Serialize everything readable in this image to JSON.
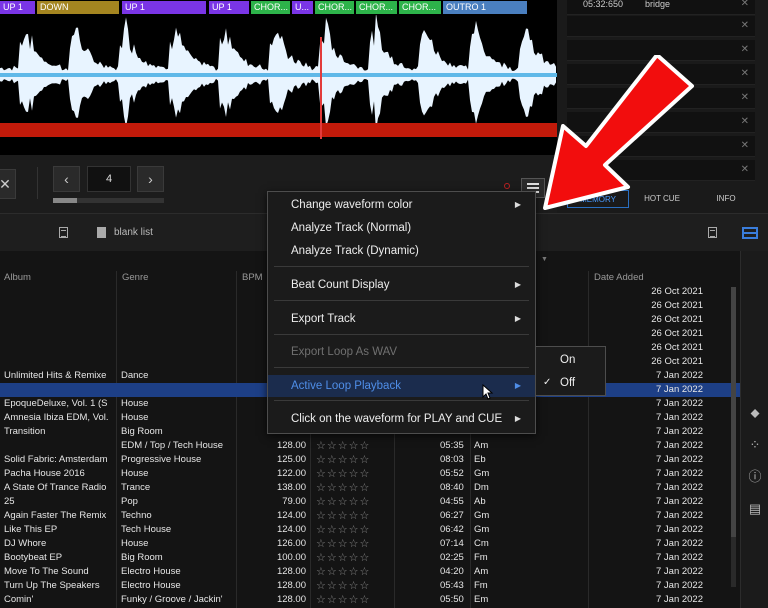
{
  "phrases": [
    {
      "label": "UP 1",
      "color": "#7a35e6"
    },
    {
      "label": "DOWN",
      "color": "#a48520"
    },
    {
      "label": "UP 1",
      "color": "#7a35e6"
    },
    {
      "label": "UP 1",
      "color": "#7a35e6"
    },
    {
      "label": "CHOR...",
      "color": "#2db34a"
    },
    {
      "label": "U...",
      "color": "#7a35e6"
    },
    {
      "label": "CHOR...",
      "color": "#2db34a"
    },
    {
      "label": "CHOR...",
      "color": "#2db34a"
    },
    {
      "label": "CHOR...",
      "color": "#2db34a"
    },
    {
      "label": "OUTRO 1",
      "color": "#4a7fbf"
    }
  ],
  "memory": {
    "first_time": "05:32:650",
    "first_name": "bridge",
    "tabs": [
      "MEMORY",
      "HOT CUE",
      "INFO"
    ]
  },
  "deck": {
    "loop_beats": "4"
  },
  "browser": {
    "playlist_name": "blank list"
  },
  "columns": {
    "album": "Album",
    "genre": "Genre",
    "bpm": "BPM",
    "date_added": "Date Added"
  },
  "rows": [
    {
      "album": "",
      "genre": "",
      "bpm": "",
      "time": "",
      "key": "",
      "date": "26 Oct 2021",
      "stars": false
    },
    {
      "album": "",
      "genre": "",
      "bpm": "",
      "time": "",
      "key": "",
      "date": "26 Oct 2021",
      "stars": false
    },
    {
      "album": "",
      "genre": "",
      "bpm": "",
      "time": "",
      "key": "",
      "date": "26 Oct 2021",
      "stars": false
    },
    {
      "album": "",
      "genre": "",
      "bpm": "",
      "time": "",
      "key": "",
      "date": "26 Oct 2021",
      "stars": false
    },
    {
      "album": "",
      "genre": "",
      "bpm": "",
      "time": "",
      "key": "",
      "date": "26 Oct 2021",
      "stars": false
    },
    {
      "album": "",
      "genre": "",
      "bpm": "",
      "time": "",
      "key": "",
      "date": "26 Oct 2021",
      "stars": false
    },
    {
      "album": "Unlimited Hits & Remixe",
      "genre": "Dance",
      "bpm": "",
      "time": "",
      "key": "",
      "date": "7 Jan 2022",
      "stars": false
    },
    {
      "album": "",
      "genre": "",
      "bpm": "",
      "time": "",
      "key": "",
      "date": "7 Jan 2022",
      "stars": false,
      "selected": true
    },
    {
      "album": "EpoqueDeluxe, Vol. 1 (S",
      "genre": "House",
      "bpm": "",
      "time": "",
      "key": "",
      "date": "7 Jan 2022",
      "stars": false
    },
    {
      "album": "Amnesia Ibiza EDM, Vol.",
      "genre": "House",
      "bpm": "",
      "time": "",
      "key": "",
      "date": "7 Jan 2022",
      "stars": false
    },
    {
      "album": "Transition",
      "genre": "Big Room",
      "bpm": "",
      "time": "",
      "key": "",
      "date": "7 Jan 2022",
      "stars": false
    },
    {
      "album": "",
      "genre": "EDM / Top / Tech House",
      "bpm": "128.00",
      "time": "05:35",
      "key": "Am",
      "date": "7 Jan 2022",
      "stars": true
    },
    {
      "album": "Solid Fabric: Amsterdam",
      "genre": "Progressive House",
      "bpm": "125.00",
      "time": "08:03",
      "key": "Eb",
      "date": "7 Jan 2022",
      "stars": true
    },
    {
      "album": "Pacha House 2016",
      "genre": "House",
      "bpm": "122.00",
      "time": "05:52",
      "key": "Gm",
      "date": "7 Jan 2022",
      "stars": true
    },
    {
      "album": "A State Of Trance Radio",
      "genre": "Trance",
      "bpm": "138.00",
      "time": "08:40",
      "key": "Dm",
      "date": "7 Jan 2022",
      "stars": true
    },
    {
      "album": "25",
      "genre": "Pop",
      "bpm": "79.00",
      "time": "04:55",
      "key": "Ab",
      "date": "7 Jan 2022",
      "stars": true
    },
    {
      "album": "Again Faster The Remix",
      "genre": "Techno",
      "bpm": "124.00",
      "time": "06:27",
      "key": "Gm",
      "date": "7 Jan 2022",
      "stars": true
    },
    {
      "album": "Like This EP",
      "genre": "Tech House",
      "bpm": "124.00",
      "time": "06:42",
      "key": "Gm",
      "date": "7 Jan 2022",
      "stars": true
    },
    {
      "album": "DJ Whore",
      "genre": "House",
      "bpm": "126.00",
      "time": "07:14",
      "key": "Cm",
      "date": "7 Jan 2022",
      "stars": true
    },
    {
      "album": "Bootybeat EP",
      "genre": "Big Room",
      "bpm": "100.00",
      "time": "02:25",
      "key": "Fm",
      "date": "7 Jan 2022",
      "stars": true
    },
    {
      "album": "Move To The Sound",
      "genre": "Electro House",
      "bpm": "128.00",
      "time": "04:20",
      "key": "Am",
      "date": "7 Jan 2022",
      "stars": true
    },
    {
      "album": "Turn Up The Speakers",
      "genre": "Electro House",
      "bpm": "128.00",
      "time": "05:43",
      "key": "Fm",
      "date": "7 Jan 2022",
      "stars": true
    },
    {
      "album": "Comin'",
      "genre": "Funky / Groove / Jackin'",
      "bpm": "128.00",
      "time": "05:50",
      "key": "Em",
      "date": "7 Jan 2022",
      "stars": true
    }
  ],
  "context_menu": {
    "items": [
      {
        "label": "Change waveform color",
        "submenu": true
      },
      {
        "label": "Analyze Track (Normal)",
        "submenu": false
      },
      {
        "label": "Analyze Track (Dynamic)",
        "submenu": false
      },
      {
        "label": "Beat Count Display",
        "submenu": true
      },
      {
        "label": "Export Track",
        "submenu": true
      },
      {
        "label": "Export Loop As WAV",
        "submenu": false,
        "disabled": true
      },
      {
        "label": "Active Loop Playback",
        "submenu": true,
        "highlight": true
      },
      {
        "label": "Click on the waveform for PLAY and CUE",
        "submenu": true
      }
    ],
    "submenu": {
      "items": [
        {
          "label": "On",
          "checked": false
        },
        {
          "label": "Off",
          "checked": true
        }
      ]
    }
  },
  "colors": {
    "accent_blue": "#4f8ee8",
    "annotation_red": "#f20d0d",
    "waveform_white": "#e8f4ff",
    "cue_line_red": "#c21a0a"
  }
}
